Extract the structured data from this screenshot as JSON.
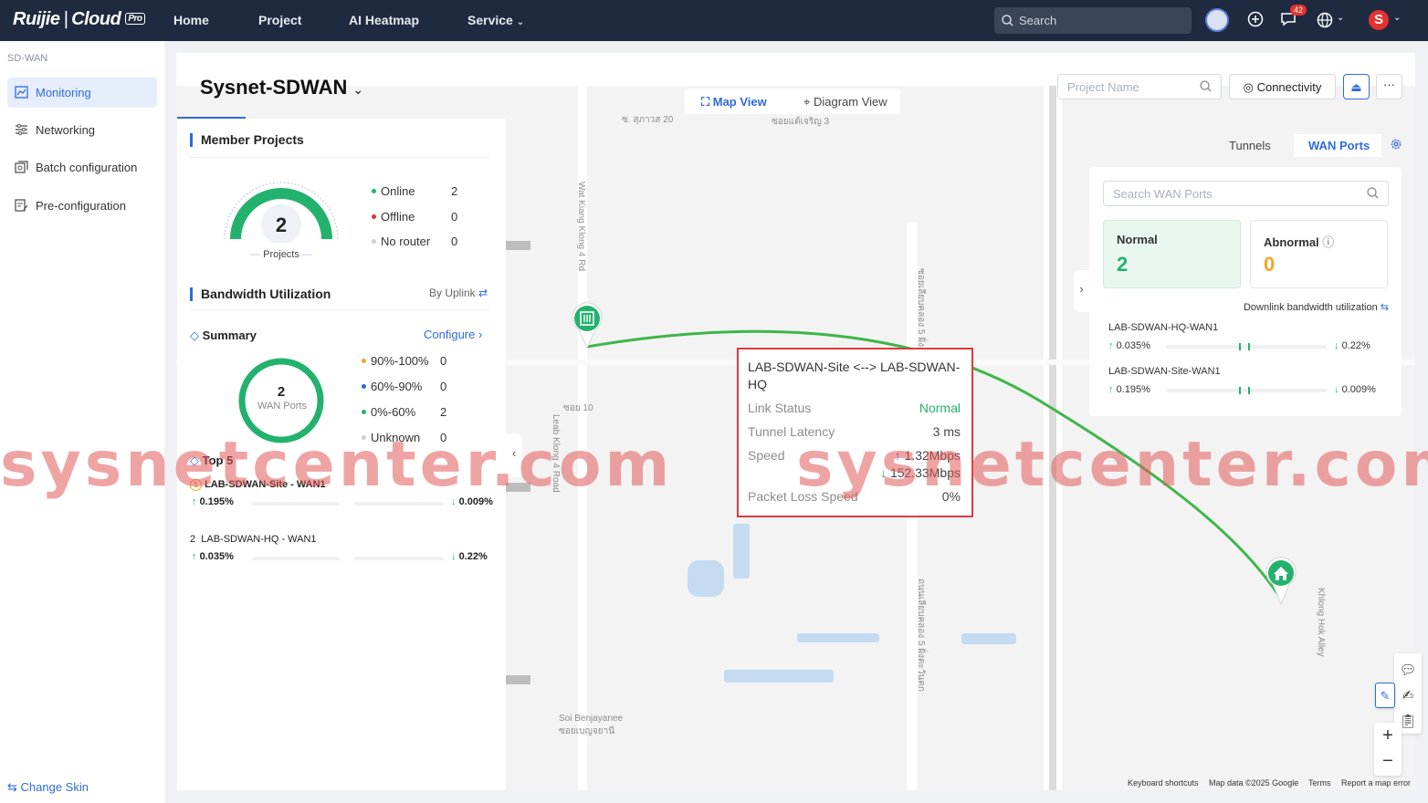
{
  "topbar": {
    "brand": "Ruijie",
    "product": "Cloud",
    "badge": "Pro",
    "nav": [
      "Home",
      "Project",
      "AI Heatmap",
      "Service"
    ],
    "search_placeholder": "Search",
    "notification_count": "42",
    "avatar_letter": "S"
  },
  "sidebar": {
    "section": "SD-WAN",
    "items": [
      {
        "label": "Monitoring",
        "active": true
      },
      {
        "label": "Networking"
      },
      {
        "label": "Batch configuration"
      },
      {
        "label": "Pre-configuration"
      }
    ],
    "change_skin": "Change Skin"
  },
  "header": {
    "title": "Sysnet-SDWAN",
    "project_placeholder": "Project Name",
    "connectivity_label": "Connectivity"
  },
  "map_view": {
    "map_view_label": "Map View",
    "diagram_view_label": "Diagram View",
    "street_labels": [
      "ซ. สุภาวส 20",
      "ซอยแต้เจริญ 3",
      "Wat Kiang Klong 4 Rd",
      "ซอย 10",
      "Leab Klong 4 Road",
      "Soi Benjayanee",
      "ซอยเบญจยานี",
      "Khlong Hok Alley",
      "ซอยเลียบคลอง 5 ฝั่งตะวันออก",
      "ถนนเลียบคลอง 5 ฝั่งตะวันตก"
    ],
    "footer": [
      "Keyboard shortcuts",
      "Map data ©2025 Google",
      "Terms",
      "Report a map error"
    ]
  },
  "member_projects": {
    "title": "Member Projects",
    "total": "2",
    "gauge_label": "Projects",
    "legend": [
      {
        "label": "Online",
        "value": "2",
        "color": "#23b26d"
      },
      {
        "label": "Offline",
        "value": "0",
        "color": "#e5312f"
      },
      {
        "label": "No router",
        "value": "0",
        "color": "#d0d0d0"
      }
    ]
  },
  "bandwidth": {
    "title": "Bandwidth Utilization",
    "by_uplink": "By Uplink",
    "summary_label": "Summary",
    "configure_label": "Configure",
    "donut_value": "2",
    "donut_label": "WAN Ports",
    "legend": [
      {
        "label": "90%-100%",
        "value": "0",
        "color": "#f5a623"
      },
      {
        "label": "60%-90%",
        "value": "0",
        "color": "#2f6bdc"
      },
      {
        "label": "0%-60%",
        "value": "2",
        "color": "#23b26d"
      },
      {
        "label": "Unknown",
        "value": "0",
        "color": "#d0d0d0"
      }
    ],
    "top5_label": "Top 5",
    "top5": [
      {
        "rank": "1",
        "name": "LAB-SDWAN-Site - WAN1",
        "up": "0.195%",
        "down": "0.009%"
      },
      {
        "rank": "2",
        "name": "LAB-SDWAN-HQ - WAN1",
        "up": "0.035%",
        "down": "0.22%"
      }
    ]
  },
  "right_panel": {
    "tabs": [
      "Tunnels",
      "WAN Ports"
    ],
    "active_tab": "WAN Ports",
    "search_placeholder": "Search WAN Ports",
    "normal_label": "Normal",
    "normal_value": "2",
    "abnormal_label": "Abnormal",
    "abnormal_value": "0",
    "downlink_label": "Downlink bandwidth utilization",
    "ports": [
      {
        "name": "LAB-SDWAN-HQ-WAN1",
        "up": "0.035%",
        "down": "0.22%"
      },
      {
        "name": "LAB-SDWAN-Site-WAN1",
        "up": "0.195%",
        "down": "0.009%"
      }
    ]
  },
  "tooltip": {
    "title": "LAB-SDWAN-Site <--> LAB-SDWAN-HQ",
    "link_status_label": "Link Status",
    "link_status": "Normal",
    "latency_label": "Tunnel Latency",
    "latency": "3 ms",
    "speed_label": "Speed",
    "speed_up": "1.32Mbps",
    "speed_down": "152.33Mbps",
    "loss_label": "Packet Loss Speed",
    "loss": "0%"
  },
  "watermark": "sysnetcenter.com",
  "colors": {
    "accent": "#2f6bdc",
    "ok": "#23b26d",
    "warn": "#f5a623",
    "error": "#e5312f",
    "topbar": "#1f2a40"
  }
}
